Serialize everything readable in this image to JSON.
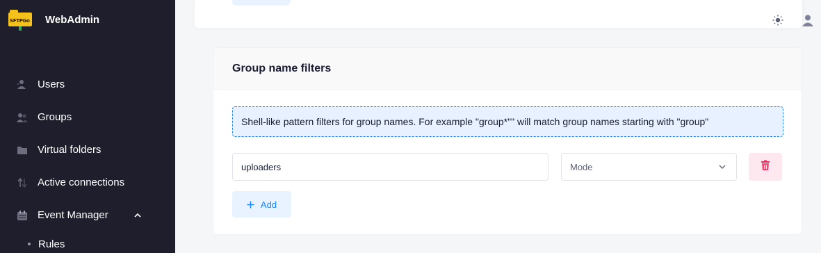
{
  "app": {
    "name": "WebAdmin",
    "logo_text": "SFTPGo"
  },
  "sidebar": {
    "items": [
      {
        "label": "Users",
        "icon": "users-icon"
      },
      {
        "label": "Groups",
        "icon": "groups-icon"
      },
      {
        "label": "Virtual folders",
        "icon": "folder-icon"
      },
      {
        "label": "Active connections",
        "icon": "connections-icon"
      },
      {
        "label": "Event Manager",
        "icon": "calendar-icon",
        "expanded": true
      }
    ],
    "sub_items": [
      {
        "label": "Rules"
      }
    ]
  },
  "header": {
    "theme_icon": "sun-icon",
    "user_icon": "user-icon"
  },
  "card": {
    "title": "Group name filters",
    "notice": "Shell-like pattern filters for group names. For example \"group*\"\" will match group names starting with \"group\"",
    "filter_value": "uploaders",
    "mode_placeholder": "Mode",
    "add_label": "Add"
  },
  "colors": {
    "sidebar_bg": "#1e1e2d",
    "accent": "#1b84ff",
    "danger": "#f8285a"
  }
}
